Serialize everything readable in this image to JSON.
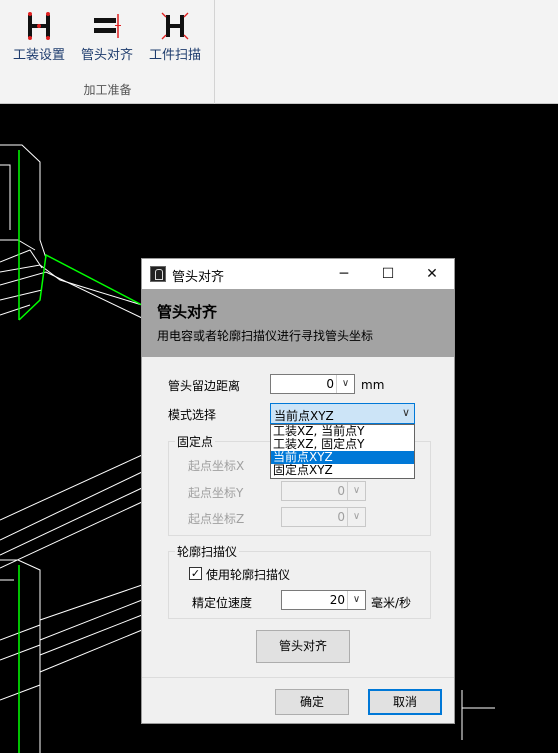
{
  "ribbon": {
    "buttons": [
      {
        "label": "工装设置",
        "icon": "fixture-setup-icon"
      },
      {
        "label": "管头对齐",
        "icon": "tube-align-icon"
      },
      {
        "label": "工件扫描",
        "icon": "workpiece-scan-icon"
      }
    ],
    "group_label": "加工准备"
  },
  "dialog": {
    "title": "管头对齐",
    "window_controls": {
      "minimize": "─",
      "maximize": "☐",
      "close": "✕"
    },
    "header_title": "管头对齐",
    "header_subtitle": "用电容或者轮廓扫描仪进行寻找管头坐标",
    "margin_label": "管头留边距离",
    "margin_value": "0",
    "margin_unit": "mm",
    "mode_label": "模式选择",
    "mode_selected": "当前点XYZ",
    "mode_options": [
      "工装XZ, 当前点Y",
      "工装XZ, 固定点Y",
      "当前点XYZ",
      "固定点XYZ"
    ],
    "fixed_point": {
      "title": "固定点",
      "x_label": "起点坐标X",
      "y_label": "起点坐标Y",
      "z_label": "起点坐标Z",
      "y_value": "0",
      "z_value": "0"
    },
    "scanner": {
      "title": "轮廓扫描仪",
      "use_scanner_label": "使用轮廓扫描仪",
      "use_scanner_checked": true,
      "speed_label": "精定位速度",
      "speed_value": "20",
      "speed_unit": "毫米/秒"
    },
    "align_button": "管头对齐",
    "ok_button": "确定",
    "cancel_button": "取消"
  },
  "colors": {
    "ribbon_text": "#1e3c6e",
    "icon_red": "#e02020",
    "header_gray": "#a3a3a3",
    "accent": "#0078d7",
    "cad_green": "#00ff00"
  }
}
